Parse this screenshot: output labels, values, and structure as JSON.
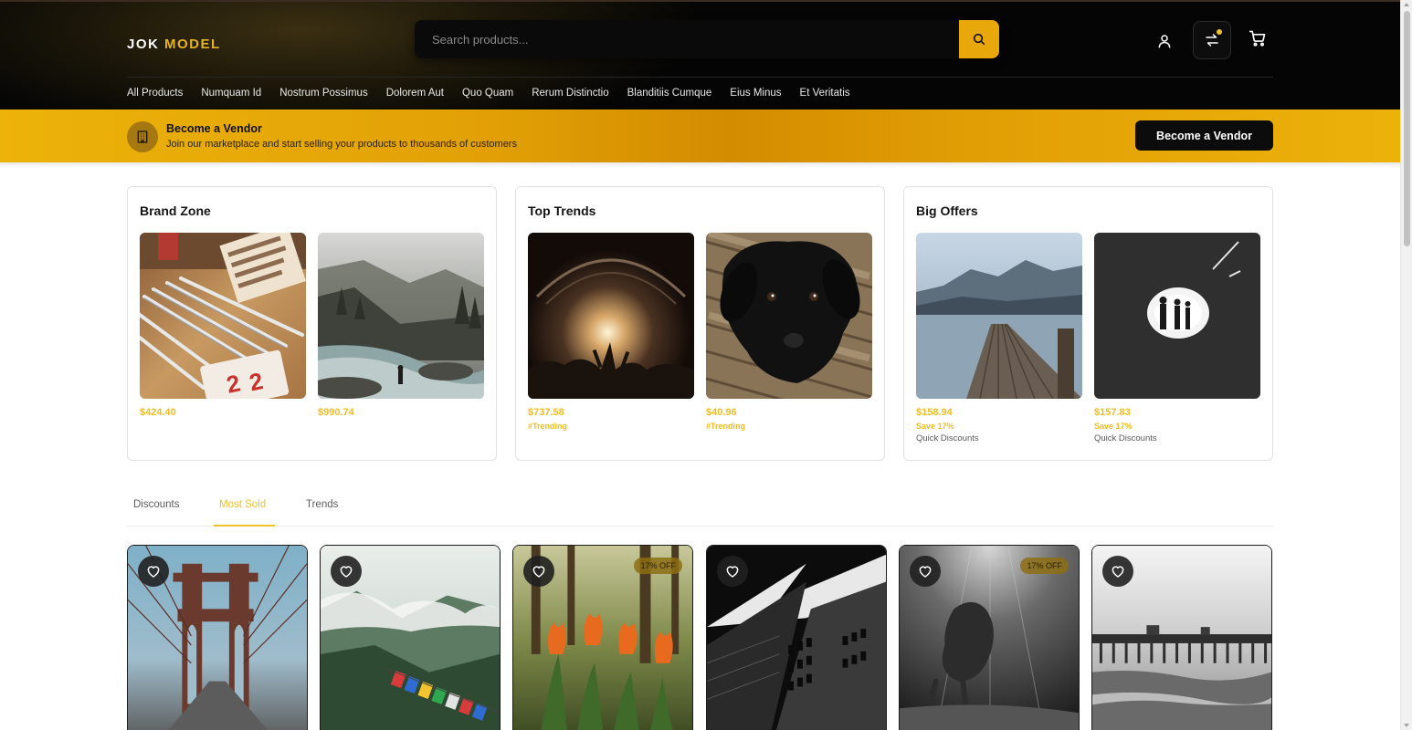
{
  "brand": {
    "name_part1": "JOK",
    "name_part2": "MODEL",
    "accent_color": "#e3b325"
  },
  "search": {
    "placeholder": "Search products...",
    "value": "",
    "icon": "search-icon"
  },
  "header_icons": [
    "user-icon",
    "compare-icon",
    "cart-icon"
  ],
  "nav": {
    "items": [
      "All Products",
      "Numquam Id",
      "Nostrum Possimus",
      "Dolorem Aut",
      "Quo Quam",
      "Rerum Distinctio",
      "Blanditiis Cumque",
      "Eius Minus",
      "Et Veritatis"
    ]
  },
  "vendor_banner": {
    "title": "Become a Vendor",
    "subtitle": "Join our marketplace and start selling your products to thousands of customers",
    "button_label": "Become a Vendor",
    "icon": "building-icon"
  },
  "cards": [
    {
      "title": "Brand Zone",
      "items": [
        {
          "price": "$424.40",
          "tag": "",
          "note": ""
        },
        {
          "price": "$990.74",
          "tag": "",
          "note": ""
        }
      ]
    },
    {
      "title": "Top Trends",
      "items": [
        {
          "price": "$737.58",
          "tag": "#Trending",
          "note": ""
        },
        {
          "price": "$40.96",
          "tag": "#Trending",
          "note": ""
        }
      ]
    },
    {
      "title": "Big Offers",
      "items": [
        {
          "price": "$158.94",
          "tag": "Save 17%",
          "note": "Quick Discounts"
        },
        {
          "price": "$157.83",
          "tag": "Save 17%",
          "note": "Quick Discounts"
        }
      ]
    }
  ],
  "tabs": {
    "items": [
      "Discounts",
      "Most Sold",
      "Trends"
    ],
    "active": "Most Sold"
  },
  "products": [
    {
      "badge": ""
    },
    {
      "badge": ""
    },
    {
      "badge": "17% OFF"
    },
    {
      "badge": ""
    },
    {
      "badge": "17% OFF"
    },
    {
      "badge": ""
    }
  ],
  "colors": {
    "accent": "#e8a70a",
    "header_bg": "#050505",
    "vendor_bar": "#e2a006",
    "price": "#efbd21"
  }
}
